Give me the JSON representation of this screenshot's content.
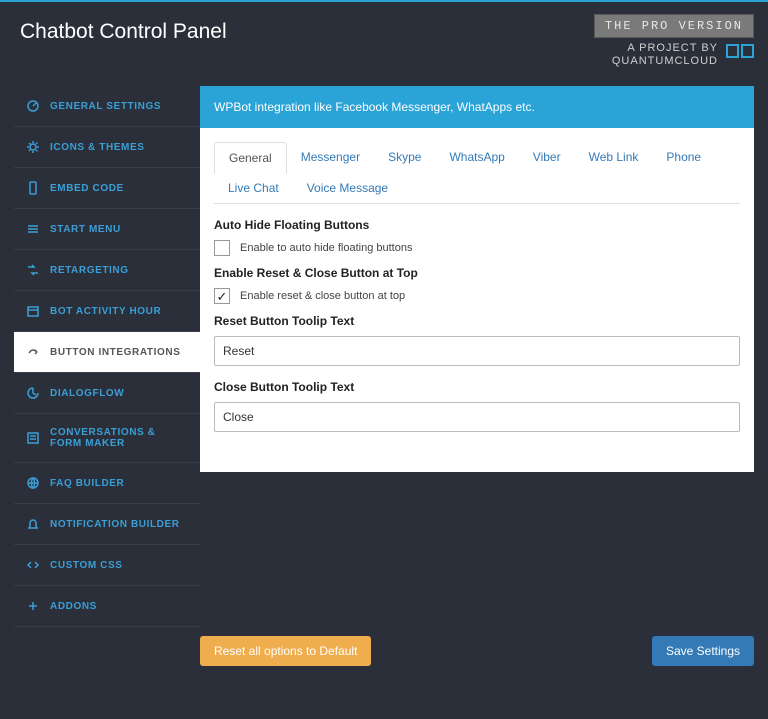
{
  "header": {
    "title": "Chatbot Control Panel",
    "pro_badge": "THE PRO VERSION",
    "brand_line1": "A PROJECT BY",
    "brand_line2": "QUANTUMCLOUD"
  },
  "sidebar": {
    "items": [
      {
        "label": "General Settings",
        "icon": "dashboard-icon"
      },
      {
        "label": "Icons & Themes",
        "icon": "gear-icon"
      },
      {
        "label": "Embed Code",
        "icon": "mobile-icon"
      },
      {
        "label": "Start Menu",
        "icon": "menu-icon"
      },
      {
        "label": "Retargeting",
        "icon": "retarget-icon"
      },
      {
        "label": "Bot Activity Hour",
        "icon": "calendar-icon"
      },
      {
        "label": "Button Integrations",
        "icon": "share-icon",
        "active": true
      },
      {
        "label": "DialogFlow",
        "icon": "dialog-icon"
      },
      {
        "label": "Conversations & Form Maker",
        "icon": "form-icon"
      },
      {
        "label": "FAQ Builder",
        "icon": "globe-icon"
      },
      {
        "label": "Notification Builder",
        "icon": "bell-icon"
      },
      {
        "label": "Custom CSS",
        "icon": "code-icon"
      },
      {
        "label": "Addons",
        "icon": "plus-icon"
      }
    ]
  },
  "panel": {
    "banner": "WPBot integration like Facebook Messenger, WhatApps etc.",
    "tabs": [
      {
        "label": "General",
        "active": true
      },
      {
        "label": "Messenger"
      },
      {
        "label": "Skype"
      },
      {
        "label": "WhatsApp"
      },
      {
        "label": "Viber"
      },
      {
        "label": "Web Link"
      },
      {
        "label": "Phone"
      },
      {
        "label": "Live Chat"
      },
      {
        "label": "Voice Message"
      }
    ],
    "fields": {
      "auto_hide_heading": "Auto Hide Floating Buttons",
      "auto_hide_label": "Enable to auto hide floating buttons",
      "auto_hide_checked": false,
      "reset_close_heading": "Enable Reset & Close Button at Top",
      "reset_close_label": "Enable reset & close button at top",
      "reset_close_checked": true,
      "reset_tooltip_heading": "Reset Button Toolip Text",
      "reset_tooltip_value": "Reset",
      "close_tooltip_heading": "Close Button Toolip Text",
      "close_tooltip_value": "Close"
    }
  },
  "footer": {
    "reset_button": "Reset all options to Default",
    "save_button": "Save Settings"
  }
}
